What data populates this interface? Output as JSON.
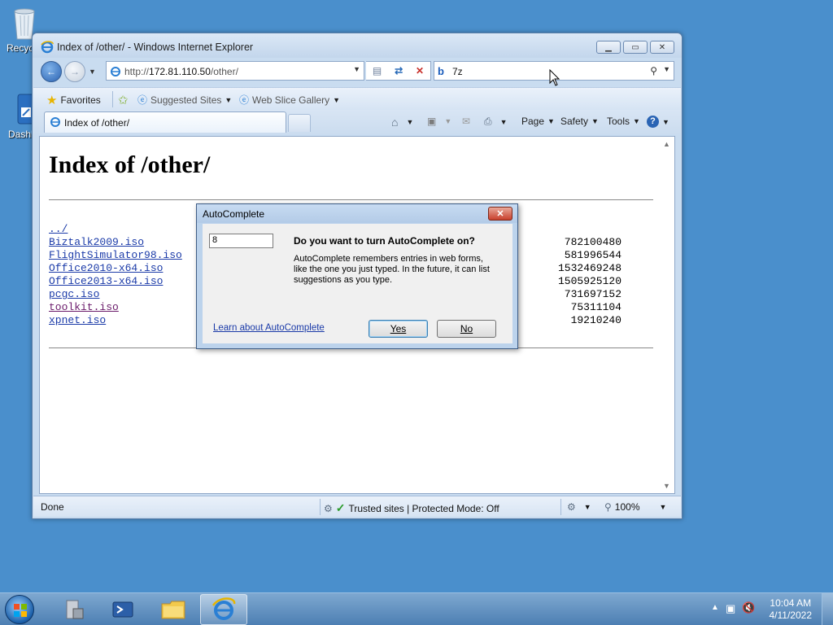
{
  "desktop": {
    "icons": [
      {
        "label": "Recycle Bin"
      },
      {
        "label": "Dashboard"
      }
    ]
  },
  "window": {
    "title": "Index of /other/ - Windows Internet Explorer",
    "address": {
      "prefix": "http://",
      "host": "172.81.110.50",
      "path": "/other/"
    },
    "search": {
      "value": "7z"
    },
    "favorites": {
      "favorites_label": "Favorites",
      "suggested_sites": "Suggested Sites",
      "web_slice_gallery": "Web Slice Gallery"
    },
    "tab": {
      "label": "Index of /other/"
    },
    "commands": {
      "page": "Page",
      "safety": "Safety",
      "tools": "Tools"
    },
    "status": {
      "text": "Done",
      "zone": "Trusted sites | Protected Mode: Off",
      "zoom": "100%"
    }
  },
  "page": {
    "heading": "Index of /other/",
    "parent_link": "../",
    "files": [
      {
        "name": "Biztalk2009.iso",
        "size": "782100480",
        "visited": false
      },
      {
        "name": "FlightSimulator98.iso",
        "size": "581996544",
        "visited": false
      },
      {
        "name": "Office2010-x64.iso",
        "size": "1532469248",
        "visited": false
      },
      {
        "name": "Office2013-x64.iso",
        "size": "1505925120",
        "visited": false
      },
      {
        "name": "pcgc.iso",
        "size": "731697152",
        "visited": false
      },
      {
        "name": "toolkit.iso",
        "size": "75311104",
        "visited": true
      },
      {
        "name": "xpnet.iso",
        "size": "19210240",
        "visited": false
      }
    ]
  },
  "dialog": {
    "title": "AutoComplete",
    "input_value": "8",
    "question": "Do you want to turn AutoComplete on?",
    "description": "AutoComplete remembers entries in web forms, like the one you just typed. In the future, it can list suggestions as you type.",
    "learn_link": "Learn about AutoComplete",
    "yes_label": "Yes",
    "no_label": "No"
  },
  "taskbar": {
    "time": "10:04 AM",
    "date": "4/11/2022"
  },
  "colors": {
    "desktop": "#4a8fcc",
    "link": "#1a3aa8",
    "visited_link": "#6a1a6a"
  }
}
